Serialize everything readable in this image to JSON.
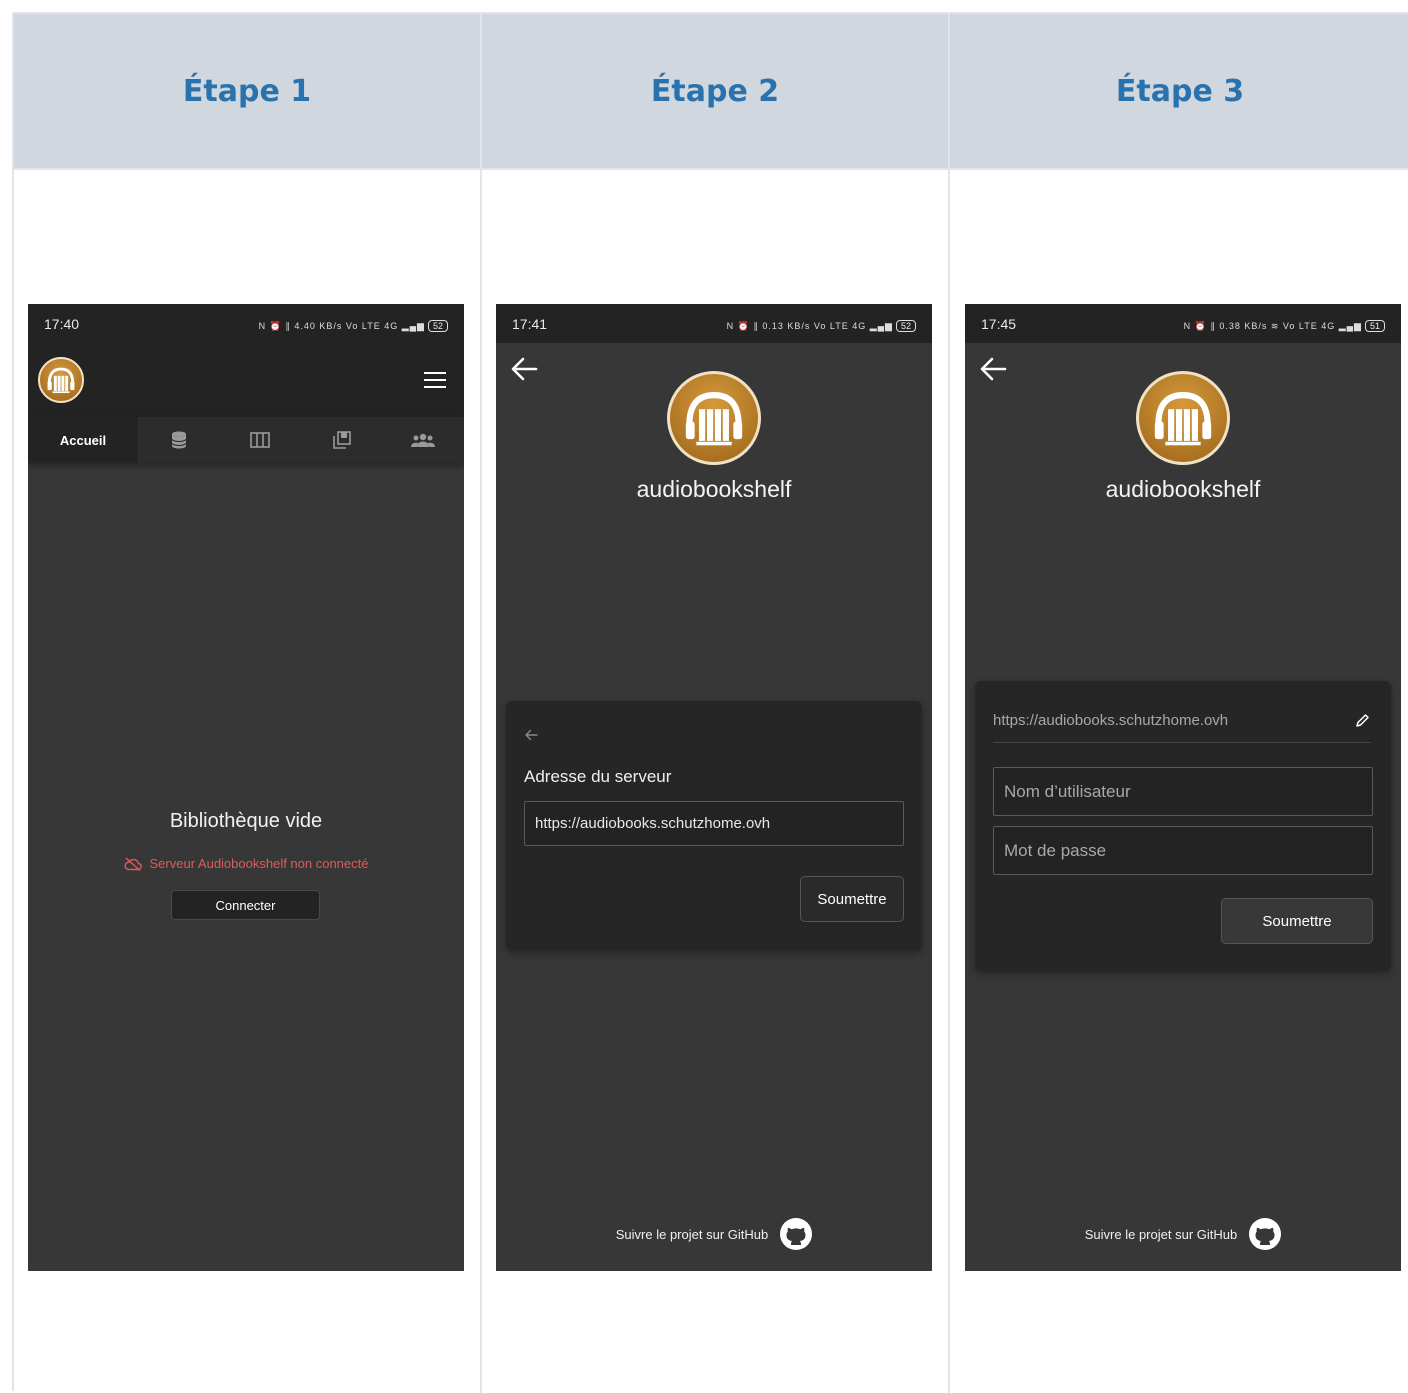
{
  "columns": [
    {
      "title": "Étape 1"
    },
    {
      "title": "Étape 2"
    },
    {
      "title": "Étape 3"
    }
  ],
  "step1": {
    "time": "17:40",
    "status_icons": "N ⏰ ∥ 4.40 KB/s Vo LTE 4G ▂▄▆",
    "battery": "52",
    "tabs": [
      "Accueil"
    ],
    "empty_title": "Bibliothèque vide",
    "warning": "Serveur Audiobookshelf non connecté",
    "connect_label": "Connecter"
  },
  "step2": {
    "time": "17:41",
    "status_icons": "N ⏰ ∥ 0.13 KB/s Vo LTE 4G ▂▄▆",
    "battery": "52",
    "brand": "audiobookshelf",
    "server_label": "Adresse du serveur",
    "server_value": "https://audiobooks.schutzhome.ovh",
    "submit_label": "Soumettre",
    "footer_text": "Suivre le projet sur GitHub"
  },
  "step3": {
    "time": "17:45",
    "status_icons": "N ⏰ ∥ 0.38 KB/s ≋ Vo LTE 4G ▂▄▆",
    "battery": "51",
    "brand": "audiobookshelf",
    "server_value": "https://audiobooks.schutzhome.ovh",
    "username_placeholder": "Nom d’utilisateur",
    "password_placeholder": "Mot de passe",
    "submit_label": "Soumettre",
    "footer_text": "Suivre le projet sur GitHub"
  },
  "colors": {
    "header_bg": "#d0d7de",
    "header_text": "#2a72ad",
    "app_bg": "#373737",
    "bar_bg": "#232323",
    "warning": "#e05a5a",
    "logo_gold": "#c08330"
  }
}
